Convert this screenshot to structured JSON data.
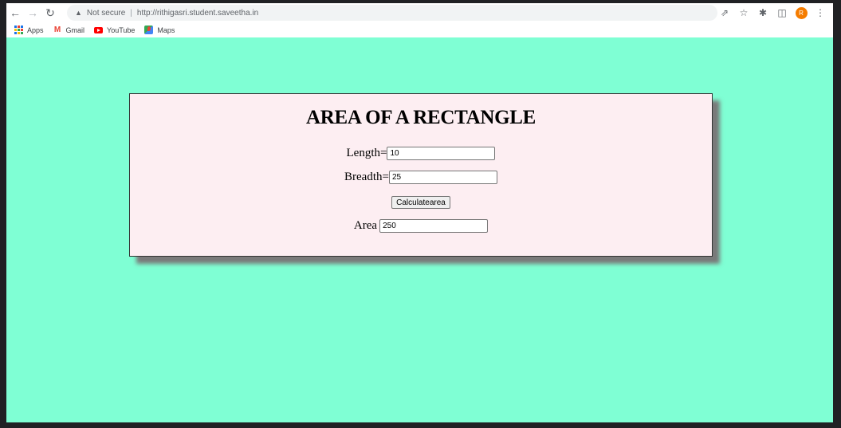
{
  "browser": {
    "security_label": "Not secure",
    "url": "http://rithigasri.student.saveetha.in",
    "profile_initial": "R"
  },
  "bookmarks": [
    {
      "label": "Apps",
      "icon": "apps-grid-icon"
    },
    {
      "label": "Gmail",
      "icon": "gmail-icon"
    },
    {
      "label": "YouTube",
      "icon": "youtube-icon"
    },
    {
      "label": "Maps",
      "icon": "maps-icon"
    }
  ],
  "page": {
    "background_color": "#7fffd4",
    "card_color": "#fdeef2",
    "title": "AREA OF A RECTANGLE",
    "length_label": "Length=",
    "length_value": "10",
    "breadth_label": "Breadth=",
    "breadth_value": "25",
    "button_label": "Calculatearea",
    "area_label": "Area",
    "area_value": "250"
  }
}
